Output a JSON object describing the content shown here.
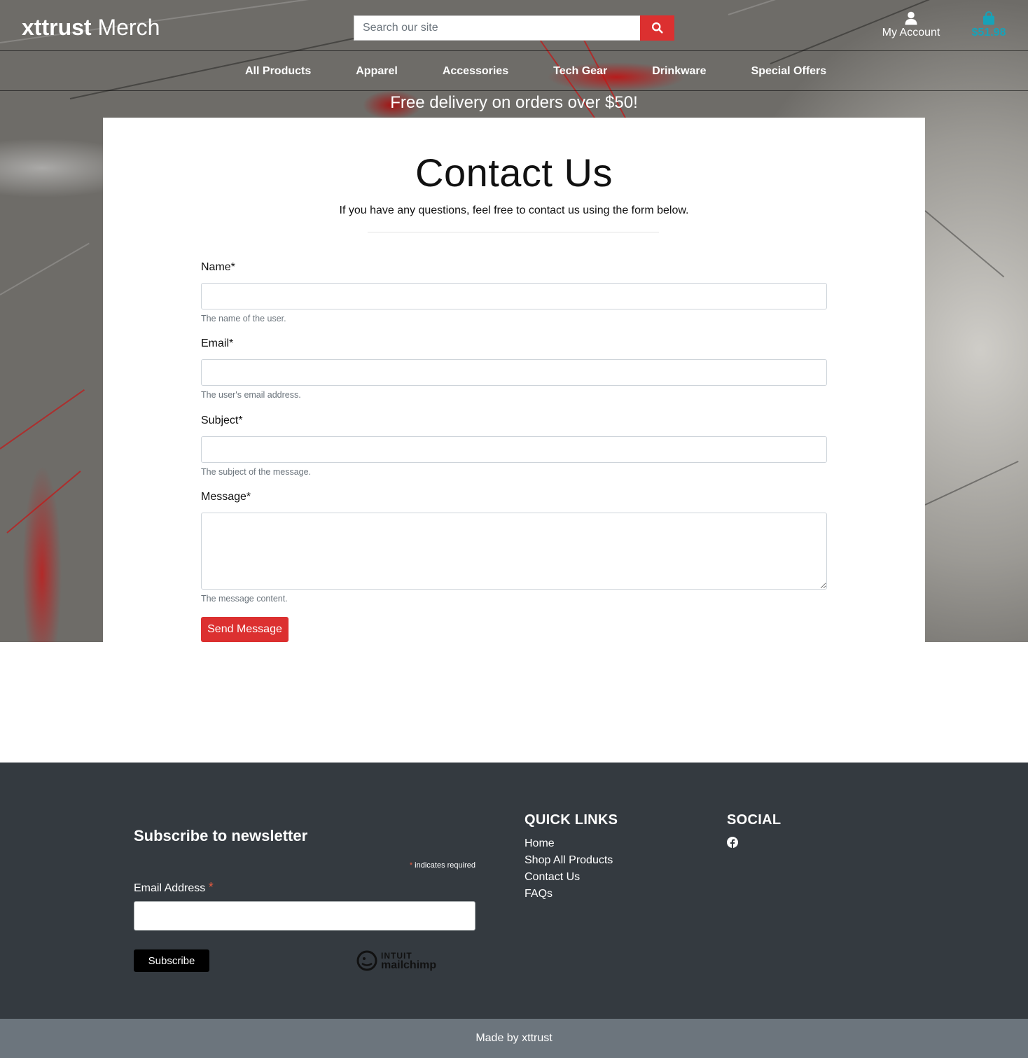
{
  "brand": {
    "bold": "xttrust",
    "light": " Merch"
  },
  "search": {
    "placeholder": "Search our site"
  },
  "account": {
    "label": "My Account"
  },
  "cart": {
    "total": "$51.98"
  },
  "nav": [
    "All Products",
    "Apparel",
    "Accessories",
    "Tech Gear",
    "Drinkware",
    "Special Offers"
  ],
  "promo": "Free delivery on orders over $50!",
  "contact": {
    "title": "Contact Us",
    "lead": "If you have any questions, feel free to contact us using the form below.",
    "fields": [
      {
        "label": "Name*",
        "help": "The name of the user."
      },
      {
        "label": "Email*",
        "help": "The user's email address."
      },
      {
        "label": "Subject*",
        "help": "The subject of the message."
      },
      {
        "label": "Message*",
        "help": "The message content."
      }
    ],
    "submit": "Send Message"
  },
  "newsletter": {
    "title": "Subscribe to newsletter",
    "required_mark": "*",
    "required_note": " indicates required",
    "email_label": "Email Address ",
    "subscribe": "Subscribe",
    "badge_line1": "INTUIT",
    "badge_line2": "mailchimp"
  },
  "quick_links": {
    "heading": "QUICK LINKS",
    "items": [
      "Home",
      "Shop All Products",
      "Contact Us",
      "FAQs"
    ]
  },
  "social": {
    "heading": "SOCIAL",
    "icons": [
      "facebook-icon"
    ]
  },
  "credit": "Made by xttrust",
  "colors": {
    "accent_red": "#dc3030",
    "cart_teal": "#17a2b8",
    "footer_dark": "#343a40",
    "footer_bottom": "#6c757d"
  }
}
